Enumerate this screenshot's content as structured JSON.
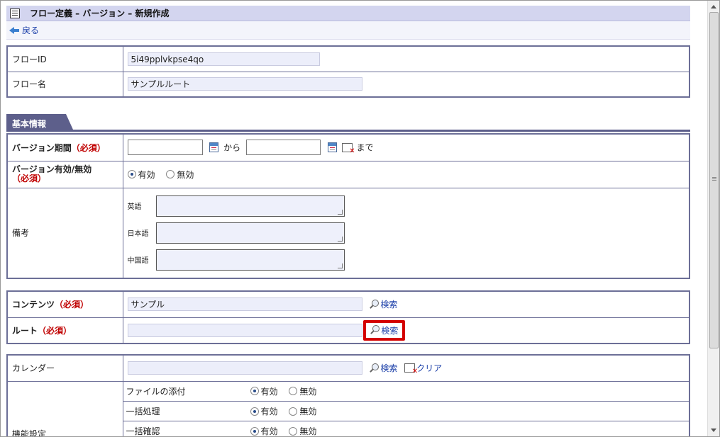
{
  "header": {
    "title": "フロー定義 – バージョン – 新規作成",
    "back_label": "戻る"
  },
  "flow": {
    "id_label": "フローID",
    "id_value": "5i49pplvkpse4qo",
    "name_label": "フロー名",
    "name_value": "サンプルルート"
  },
  "section_tab": "基本情報",
  "version_period": {
    "label": "バージョン期間",
    "required": "（必須）",
    "from": "から",
    "to": "まで"
  },
  "version_enabled": {
    "label": "バージョン有効/無効",
    "required": "（必須）",
    "options": [
      "有効",
      "無効"
    ],
    "selected": "有効"
  },
  "remarks": {
    "label": "備考",
    "lang_en": "英語",
    "lang_ja": "日本語",
    "lang_zh": "中国語"
  },
  "content": {
    "label": "コンテンツ",
    "required": "（必須）",
    "value": "サンプル",
    "search": "検索"
  },
  "route": {
    "label": "ルート",
    "required": "（必須）",
    "value": "",
    "search": "検索"
  },
  "calendar": {
    "label": "カレンダー",
    "value": "",
    "search": "検索",
    "clear": "クリア"
  },
  "features": {
    "label": "機能設定",
    "rows": [
      {
        "name": "ファイルの添付",
        "on": "有効",
        "off": "無効",
        "selected": "有効"
      },
      {
        "name": "一括処理",
        "on": "有効",
        "off": "無効",
        "selected": "有効"
      },
      {
        "name": "一括確認",
        "on": "有効",
        "off": "無効",
        "selected": "有効"
      }
    ]
  }
}
